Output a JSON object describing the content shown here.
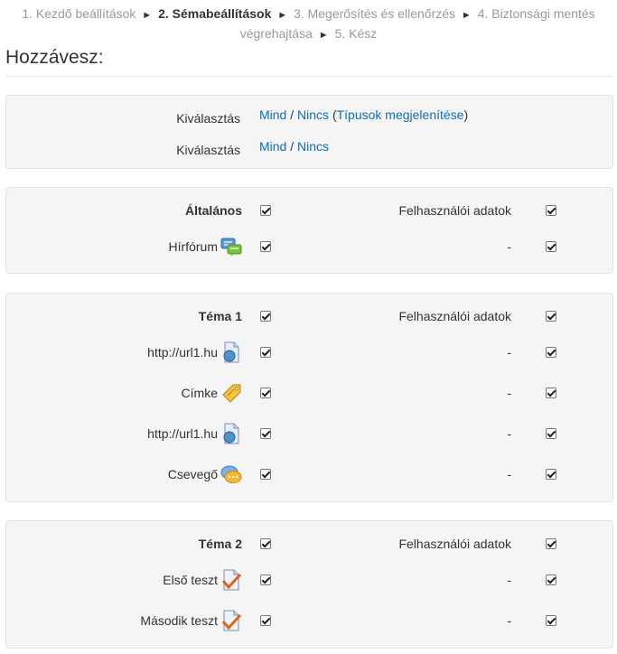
{
  "steps": {
    "s1": "1. Kezdő beállítások",
    "s2": "2. Sémabeállítások",
    "s3": "3. Megerősítés és ellenőrzés",
    "s4": "4. Biztonsági mentés végrehajtása",
    "s5": "5. Kész",
    "arrow": "►"
  },
  "page_title": "Hozzávesz:",
  "selectors": [
    {
      "label": "Kiválasztás",
      "all": "Mind",
      "none": "Nincs",
      "types": "Típusok megjelenítése"
    },
    {
      "label": "Kiválasztás",
      "all": "Mind",
      "none": "Nincs"
    }
  ],
  "sep": "/",
  "sections": [
    {
      "header": {
        "label": "Általános",
        "right_label": "Felhasználói adatok",
        "checked": true,
        "right_checked": true
      },
      "items": [
        {
          "label": "Hírfórum",
          "icon": "forum-icon",
          "right_label": "-",
          "checked": true,
          "right_checked": true
        }
      ]
    },
    {
      "header": {
        "label": "Téma 1",
        "right_label": "Felhasználói adatok",
        "checked": true,
        "right_checked": true
      },
      "items": [
        {
          "label": "http://url1.hu",
          "icon": "url-icon",
          "right_label": "-"
        },
        {
          "label": "Címke",
          "icon": "label-icon",
          "right_label": "-"
        },
        {
          "label": "http://url1.hu",
          "icon": "url-icon",
          "right_label": "-"
        },
        {
          "label": "Csevegő",
          "icon": "chat-icon",
          "right_label": "-"
        }
      ]
    },
    {
      "header": {
        "label": "Téma 2",
        "right_label": "Felhasználói adatok",
        "checked": true,
        "right_checked": true
      },
      "items": [
        {
          "label": "Első teszt",
          "icon": "quiz-icon",
          "right_label": "-"
        },
        {
          "label": "Második teszt",
          "icon": "quiz-icon",
          "right_label": "-"
        }
      ]
    }
  ]
}
